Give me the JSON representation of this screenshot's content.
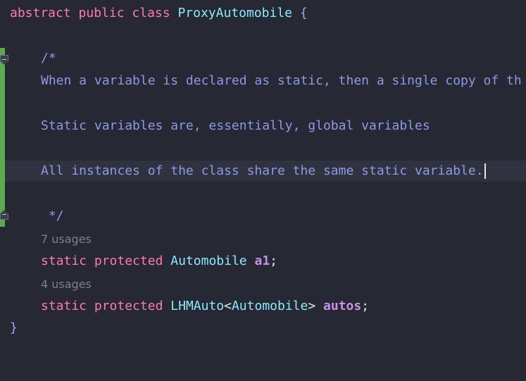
{
  "editor": {
    "class_decl": {
      "kw_abstract": "abstract",
      "kw_public": "public",
      "kw_class": "class",
      "class_name": "ProxyAutomobile",
      "open_brace": "{"
    },
    "comment": {
      "open": "/*",
      "line1": "When a variable is declared as static, then a single copy of th",
      "line2": "Static variables are, essentially, global variables",
      "line3": "All instances of the class share the same static variable.",
      "close": " */"
    },
    "field1": {
      "usages": "7 usages",
      "kw_static": "static",
      "kw_protected": "protected",
      "type": "Automobile",
      "name": "a1",
      "semicolon": ";"
    },
    "field2": {
      "usages": "4 usages",
      "kw_static": "static",
      "kw_protected": "protected",
      "type_outer": "LHMAuto",
      "lt": "<",
      "type_inner": "Automobile",
      "gt": ">",
      "name": "autos",
      "semicolon": ";"
    },
    "close_brace": "}"
  },
  "colors": {
    "background": "#262833",
    "keyword": "#ff79b0",
    "type": "#8be9fd",
    "comment": "#8d99e6",
    "field": "#c792ea",
    "gutter_change": "#5aac4e"
  }
}
